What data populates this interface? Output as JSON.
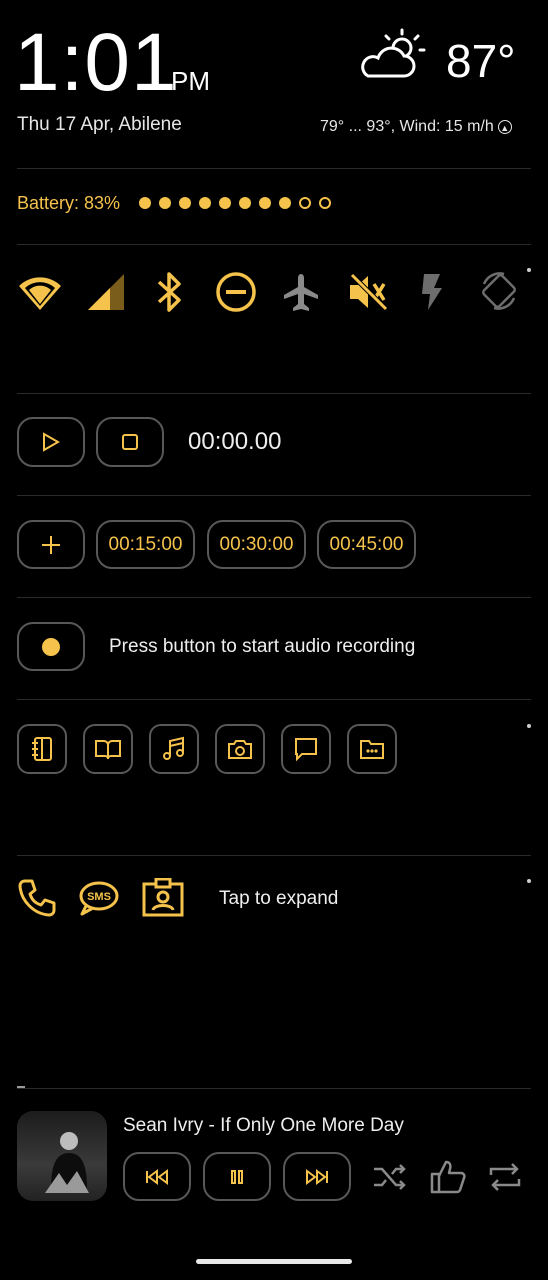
{
  "clock": {
    "time": "1:01",
    "ampm": "PM",
    "date_location": "Thu 17 Apr, Abilene"
  },
  "weather": {
    "temp": "87°",
    "details": "79° ... 93°, Wind: 15 m/h",
    "icon": "partly-cloudy-icon"
  },
  "battery": {
    "label": "Battery: 83%",
    "level": 0.83,
    "dots_filled": 8,
    "dots_total": 10
  },
  "toggles": [
    "wifi-icon",
    "signal-icon",
    "bluetooth-icon",
    "dnd-icon",
    "airplane-icon",
    "mute-icon",
    "flash-icon",
    "rotate-icon"
  ],
  "stopwatch": {
    "time": "00:00.00"
  },
  "timers": {
    "presets": [
      "00:15:00",
      "00:30:00",
      "00:45:00"
    ]
  },
  "recorder": {
    "hint": "Press button to start audio recording"
  },
  "shortcuts": [
    "notes-icon",
    "book-icon",
    "music-icon",
    "camera-icon",
    "chat-icon",
    "folder-icon"
  ],
  "contacts": {
    "hint": "Tap to expand"
  },
  "media": {
    "track": "Sean Ivry - If Only One More Day"
  },
  "colors": {
    "accent": "#F5C24B",
    "border": "#585858",
    "background": "#000000"
  }
}
